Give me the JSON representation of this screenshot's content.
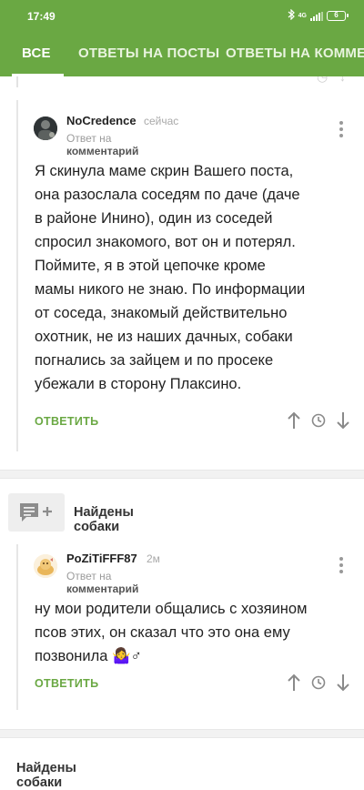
{
  "status_bar": {
    "time": "17:49",
    "network": "4G",
    "battery": "6",
    "icons": [
      "bluetooth-icon",
      "signal-icon",
      "battery-icon"
    ]
  },
  "tabs": [
    {
      "label": "ВСЕ",
      "active": true
    },
    {
      "label": "ОТВЕТЫ НА ПОСТЫ",
      "active": false
    },
    {
      "label": "ОТВЕТЫ НА КОММЕ",
      "active": false
    }
  ],
  "colors": {
    "accent": "#6aa843",
    "separator": "#f2f2f2"
  },
  "comments": [
    {
      "username": "NoCredence",
      "time": "сейчас",
      "reply_prefix": "Ответ на",
      "reply_target": "комментарий",
      "lines": [
        "Я скинула маме скрин Вашего поста,",
        "она разослала соседям по даче (даче",
        "в районе Инино), один из соседей",
        "спросил знакомого, вот он и потерял.",
        "Поймите, я в этой цепочке кроме",
        "мамы никого не знаю. По информации",
        "от соседа, знакомый действительно",
        "охотник, не из наших дачных, собаки",
        "погнались за зайцем и по просеке",
        "убежали в сторону Плаксино."
      ],
      "reply_label": "ОТВЕТИТЬ"
    },
    {
      "username": "PoZiTiFFF87",
      "time": "2м",
      "reply_prefix": "Ответ на",
      "reply_target": "комментарий",
      "lines": [
        "ну мои родители общались с хозяином",
        "псов этих, он сказал что это она ему",
        "позвонила 🤷‍♀️♂"
      ],
      "reply_label": "ОТВЕТИТЬ"
    }
  ],
  "posts": [
    {
      "title": "Найдены собаки"
    },
    {
      "title": "Найдены собаки"
    }
  ]
}
